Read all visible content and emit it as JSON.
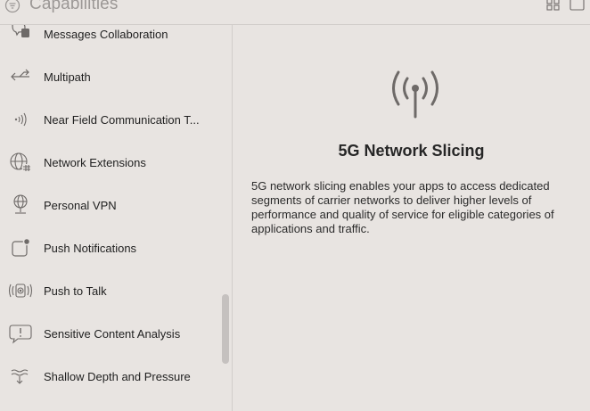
{
  "header": {
    "title": "Capabilities"
  },
  "sidebar": {
    "items": [
      {
        "label": "Messages Collaboration",
        "icon": "messages-collaboration-icon"
      },
      {
        "label": "Multipath",
        "icon": "multipath-icon"
      },
      {
        "label": "Near Field Communication T...",
        "icon": "nfc-icon"
      },
      {
        "label": "Network Extensions",
        "icon": "network-extensions-icon"
      },
      {
        "label": "Personal VPN",
        "icon": "personal-vpn-icon"
      },
      {
        "label": "Push Notifications",
        "icon": "push-notifications-icon"
      },
      {
        "label": "Push to Talk",
        "icon": "push-to-talk-icon"
      },
      {
        "label": "Sensitive Content Analysis",
        "icon": "sensitive-content-analysis-icon"
      },
      {
        "label": "Shallow Depth and Pressure",
        "icon": "shallow-depth-pressure-icon"
      }
    ]
  },
  "detail": {
    "icon": "antenna-icon",
    "title": "5G Network Slicing",
    "description": "5G network slicing enables your apps to access dedicated segments of carrier networks to deliver higher levels of performance and quality of service for eligible categories of applications and traffic."
  },
  "colors": {
    "background": "#e8e4e1",
    "icon_gray": "#6e6a68",
    "text": "#1f1f1f"
  }
}
